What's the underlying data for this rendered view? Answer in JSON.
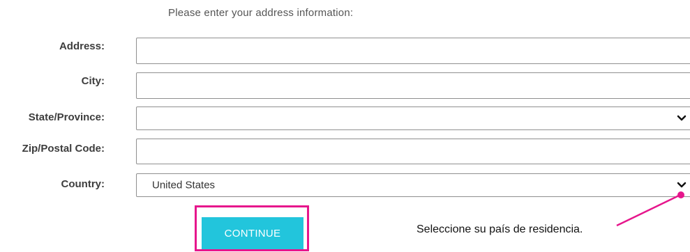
{
  "form": {
    "intro_text": "Please enter your address information:",
    "fields": {
      "address": {
        "label": "Address:",
        "value": ""
      },
      "city": {
        "label": "City:",
        "value": ""
      },
      "state": {
        "label": "State/Province:",
        "value": ""
      },
      "zip": {
        "label": "Zip/Postal Code:",
        "value": ""
      },
      "country": {
        "label": "Country:",
        "value": "United States"
      }
    },
    "continue_label": "CONTINUE"
  },
  "annotation": {
    "callout_text": "Seleccione su país de residencia."
  },
  "colors": {
    "button": "#22c5dc",
    "highlight": "#e6168c"
  },
  "icons": {
    "dropdown": "chevron-down-icon"
  }
}
